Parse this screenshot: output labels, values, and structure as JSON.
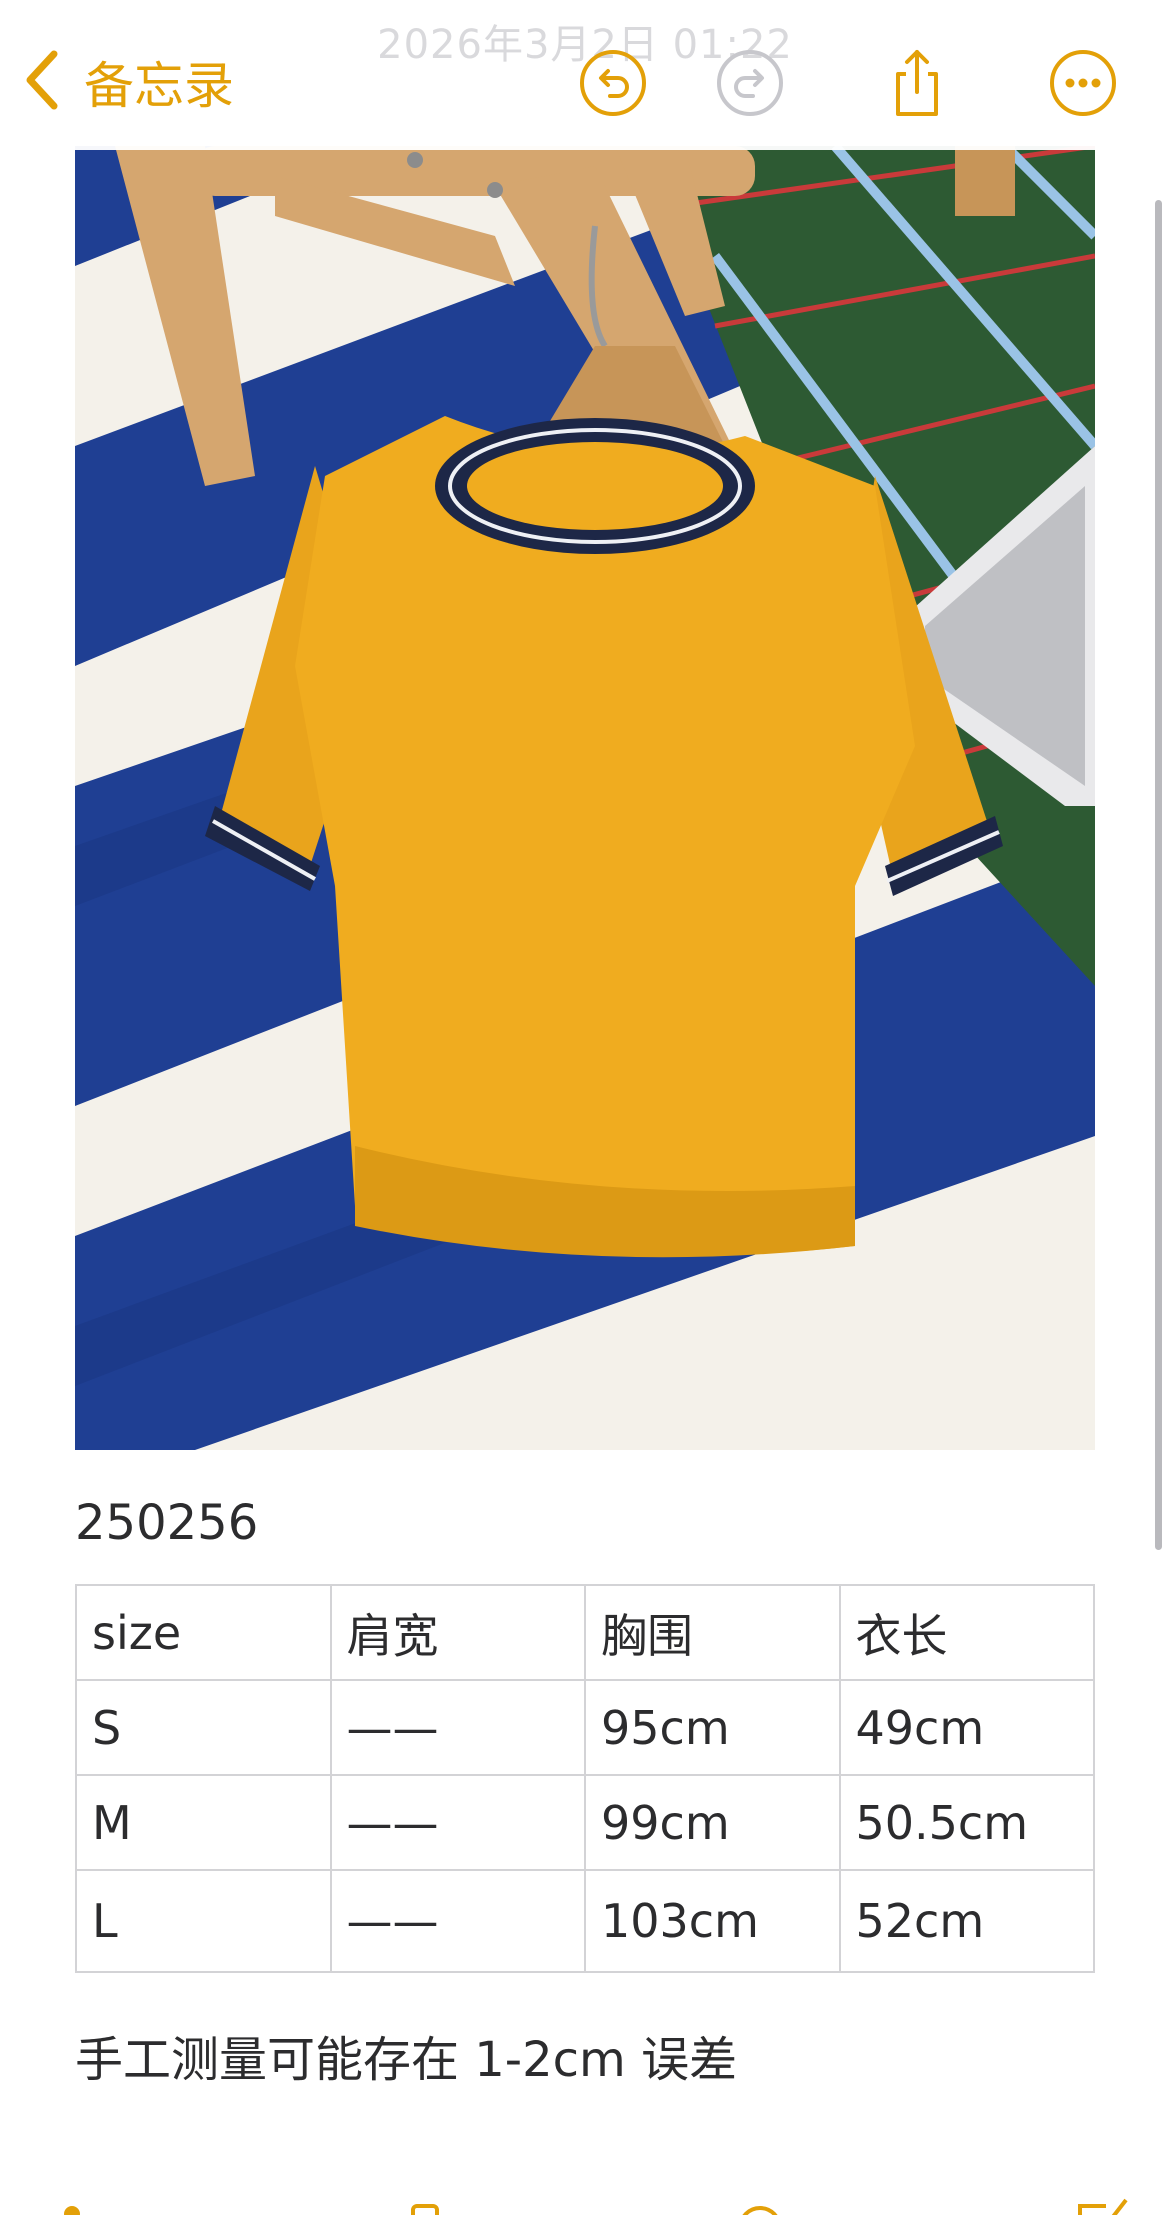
{
  "nav": {
    "faded_timestamp": "2026年3月2日 01:22",
    "back_label": "备忘录",
    "icons": [
      "chevron-left-icon",
      "undo-icon",
      "redo-icon",
      "share-icon",
      "more-icon"
    ]
  },
  "note": {
    "product_code": "250256",
    "size_table": {
      "headers": [
        "size",
        "肩宽",
        "胸围",
        "衣长"
      ],
      "rows": [
        [
          "S",
          "——",
          "95cm",
          "49cm"
        ],
        [
          "M",
          "——",
          "99cm",
          "50.5cm"
        ],
        [
          "L",
          "——",
          "103cm",
          "52cm"
        ]
      ]
    },
    "disclaimer": "手工测量可能存在 1-2cm 误差"
  },
  "toolbar": {
    "icons": [
      "checklist-icon",
      "camera-icon",
      "markup-icon",
      "compose-icon"
    ]
  },
  "colors": {
    "accent": "#e3a008",
    "sweater": "#f0ac1f",
    "trim_navy": "#1d2747",
    "rug_blue": "#1f3f93",
    "rug_cream": "#f4f1ea",
    "grass_green": "#2d5a33"
  }
}
